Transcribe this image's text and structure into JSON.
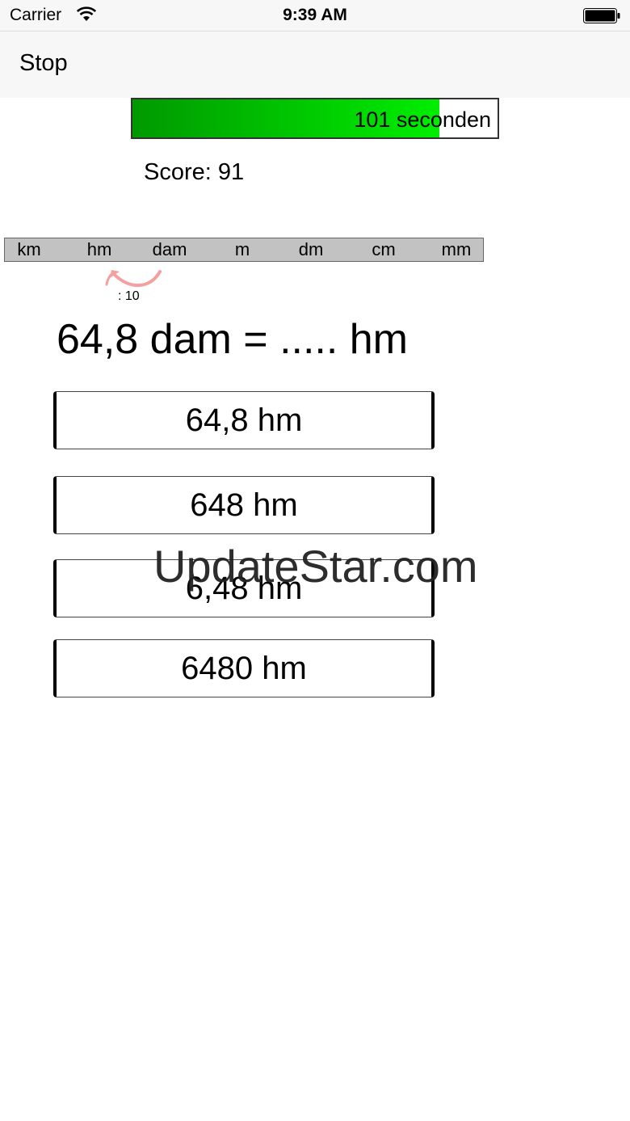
{
  "status_bar": {
    "carrier": "Carrier",
    "time": "9:39 AM"
  },
  "nav": {
    "stop_label": "Stop"
  },
  "timer": {
    "text": "101 seconden",
    "progress": 0.84,
    "fill_color": "#00cc00"
  },
  "score": {
    "text": "Score: 91"
  },
  "units": [
    "km",
    "hm",
    "dam",
    "m",
    "dm",
    "cm",
    "mm"
  ],
  "hint": {
    "text": ": 10",
    "arrow_color": "#f4a0a0"
  },
  "question": {
    "text": "64,8 dam = ..... hm"
  },
  "answers": [
    {
      "label": "64,8 hm"
    },
    {
      "label": "648 hm"
    },
    {
      "label": "6,48 hm"
    },
    {
      "label": "6480 hm"
    }
  ],
  "watermark": "UpdateStar.com"
}
